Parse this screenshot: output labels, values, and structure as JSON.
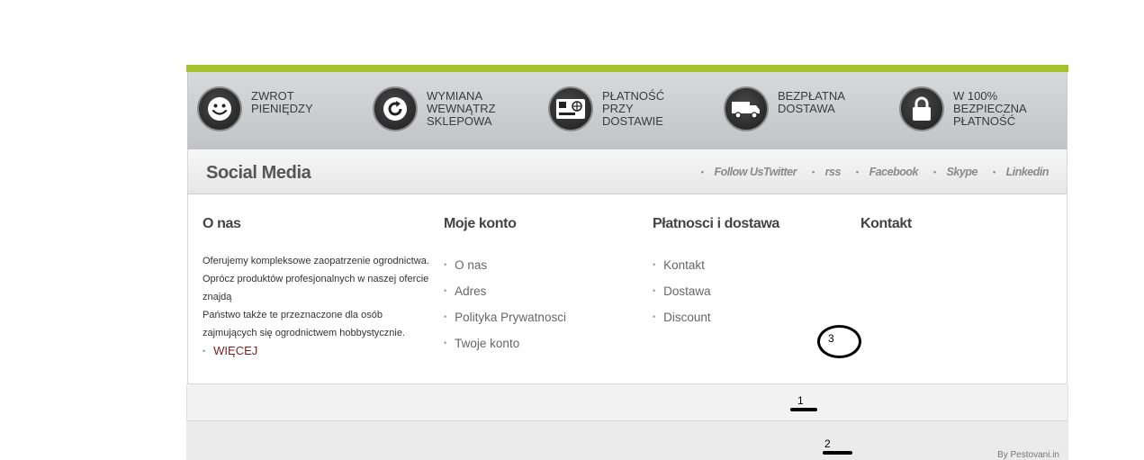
{
  "benefits": [
    {
      "label": "Zwrot\npieniędzy",
      "icon": "smiley-icon"
    },
    {
      "label": "Wymiana\nwewnątrz\nsklepowa",
      "icon": "refresh-icon"
    },
    {
      "label": "Płatność przy\ndostawie",
      "icon": "credit-card-icon"
    },
    {
      "label": "Bezpłatna\ndostawa",
      "icon": "delivery-truck-icon"
    },
    {
      "label": "W 100%\nbezpieczna\npłatność",
      "icon": "padlock-icon"
    }
  ],
  "social": {
    "title": "Social Media",
    "links": [
      "Follow UsTwitter",
      "rss",
      "Facebook",
      "Skype",
      "Linkedin"
    ]
  },
  "columns": {
    "about": {
      "heading": "O nas",
      "text": "Oferujemy kompleksowe zaopatrzenie ogrodnictwa.\nOprócz produktów profesjonalnych w naszej ofercie znajdą\nPaństwo także te przeznaczone dla osób zajmujących się ogrodnictwem hobbystycznie.",
      "more": "WIĘCEJ"
    },
    "account": {
      "heading": "Moje konto",
      "items": [
        "O nas",
        "Adres",
        "Polityka Prywatnosci",
        "Twoje konto"
      ]
    },
    "payments": {
      "heading": "Płatnosci i dostawa",
      "items": [
        "Kontakt",
        "Dostawa",
        "Discount"
      ]
    },
    "contact": {
      "heading": "Kontakt"
    }
  },
  "footer": {
    "byline": "By Pestovani.in"
  },
  "annotations": {
    "a1": "1",
    "a2": "2",
    "a3": "3"
  },
  "colors": {
    "accent": "#a6c12b",
    "more_link": "#7a1f1f"
  }
}
